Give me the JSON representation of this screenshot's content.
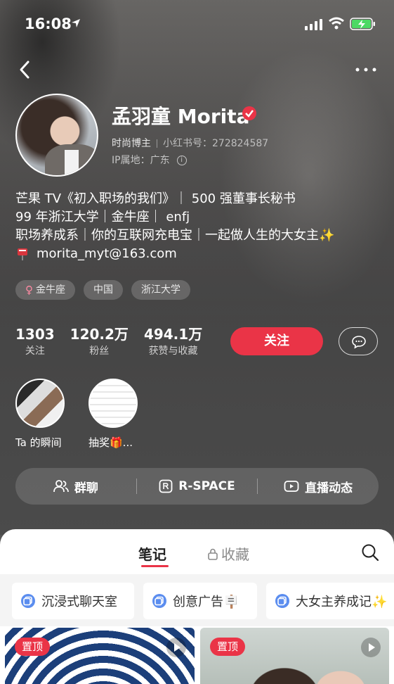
{
  "status_bar": {
    "time": "16:08",
    "location_icon": "location-arrow-icon",
    "signal_icon": "signal-icon",
    "wifi_icon": "wifi-icon",
    "battery_icon": "battery-charging-icon"
  },
  "nav": {
    "back_icon": "back-chevron-icon",
    "more_icon": "more-dots-icon"
  },
  "profile": {
    "name": "孟羽童 Morita",
    "verified_icon": "verified-badge-icon",
    "role": "时尚博主",
    "red_id": "小红书号：272824587",
    "ip_location": "IP属地：广东",
    "bio": [
      "芒果 TV《初入职场的我们》｜ 500 强董事长秘书",
      "99 年浙江大学｜金牛座｜ enfj",
      "职场养成系｜你的互联网充电宝｜一起做人生的大女主✨",
      "morita_myt@163.com"
    ],
    "tags": [
      "金牛座",
      "中国",
      "浙江大学"
    ]
  },
  "stats": [
    {
      "value": "1303",
      "label": "关注"
    },
    {
      "value": "120.2万",
      "label": "粉丝"
    },
    {
      "value": "494.1万",
      "label": "获赞与收藏"
    }
  ],
  "buttons": {
    "follow": "关注",
    "chat_icon": "chat-bubble-icon"
  },
  "moments": [
    {
      "caption": "Ta 的瞬间"
    },
    {
      "caption": "抽奖🎁..."
    }
  ],
  "actions": [
    {
      "label": "群聊",
      "icon": "group-icon"
    },
    {
      "label": "R-SPACE",
      "icon": "r-space-icon"
    },
    {
      "label": "直播动态",
      "icon": "live-video-icon"
    }
  ],
  "tabs": {
    "notes": "笔记",
    "favorites": "收藏",
    "search_icon": "search-icon"
  },
  "collections": [
    "沉浸式聊天室",
    "创意广告🪧",
    "大女主养成记✨"
  ],
  "cards": [
    {
      "badge": "置顶"
    },
    {
      "badge": "置顶"
    }
  ],
  "colors": {
    "accent": "#ea3447",
    "panel": "#ffffff"
  }
}
